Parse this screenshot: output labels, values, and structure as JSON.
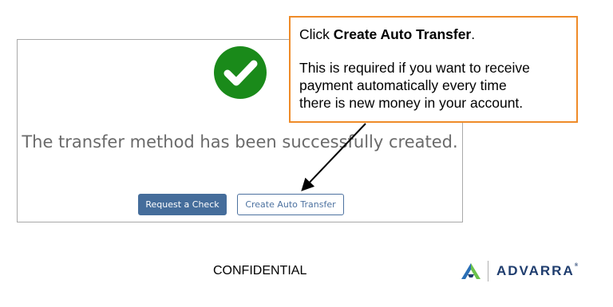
{
  "panel": {
    "success_message": "The transfer method has been successfully created.",
    "request_check_label": "Request a Check",
    "create_auto_transfer_label": "Create Auto Transfer",
    "success_icon": "check-circle-icon",
    "success_color": "#1a8a1a"
  },
  "callout": {
    "prefix": "Click ",
    "bold": "Create Auto Transfer",
    "suffix": ".",
    "line1": "This is required if you want to receive",
    "line2": "payment automatically every time",
    "line3": "there is new money in your account.",
    "border_color": "#ef8b28"
  },
  "footer": {
    "confidential": "CONFIDENTIAL",
    "logo_text": "ADVARRA",
    "logo_tm": "®",
    "logo_icon": "advarra-mark-icon"
  },
  "colors": {
    "primary_button": "#456d9b",
    "secondary_border": "#4d72a0",
    "brand_navy": "#1f3d6e",
    "brand_green": "#6cc24a"
  }
}
